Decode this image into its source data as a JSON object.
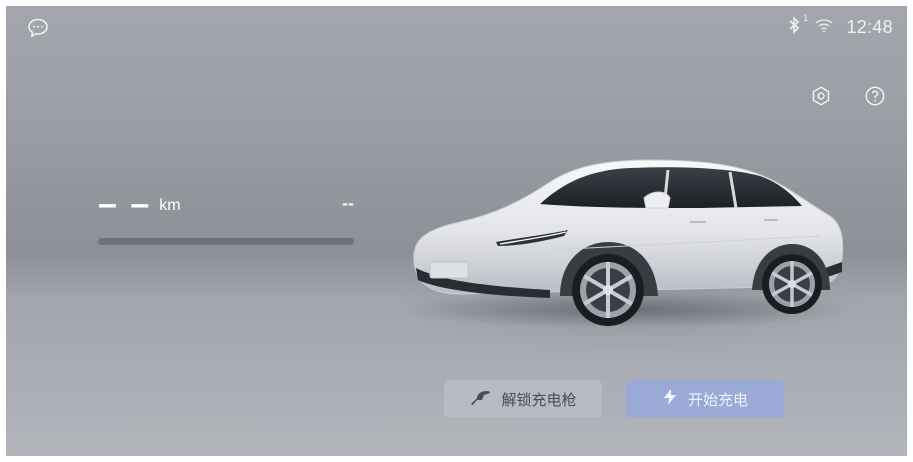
{
  "status": {
    "bluetooth_icon": "bluetooth-icon",
    "bluetooth_badge": "1",
    "wifi_icon": "wifi-icon",
    "time": "12:48",
    "message_icon": "chat-bubble-icon"
  },
  "range": {
    "value": "– –",
    "unit": "km",
    "percent": "--",
    "progress_fraction": 0
  },
  "buttons": {
    "unlock_label": "解锁充电枪",
    "charge_label": "开始充电",
    "unlock_icon": "charging-gun-icon",
    "charge_icon": "lightning-icon"
  },
  "toolbar": {
    "settings_icon": "settings-hexagon-icon",
    "help_icon": "help-circle-icon"
  },
  "colors": {
    "charge_button": "#9aa9d6",
    "unlock_button": "#b9bbc2",
    "progress_track": "#6f717a"
  }
}
